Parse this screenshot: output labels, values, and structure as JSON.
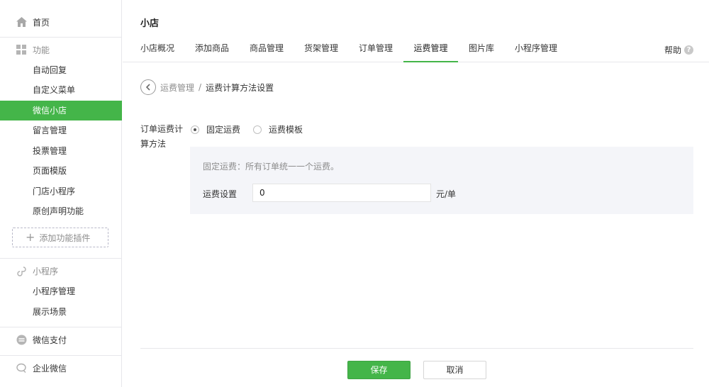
{
  "sidebar": {
    "home": {
      "label": "首页",
      "icon": "home-icon"
    },
    "features": {
      "label": "功能",
      "icon": "grid-icon"
    },
    "feature_items": [
      "自动回复",
      "自定义菜单",
      "微信小店",
      "留言管理",
      "投票管理",
      "页面模版",
      "门店小程序",
      "原创声明功能"
    ],
    "active_item": "微信小店",
    "add_plugin": "添加功能插件",
    "miniprogram": {
      "label": "小程序",
      "icon": "link-icon"
    },
    "miniprogram_items": [
      "小程序管理",
      "展示场景"
    ],
    "wechat_pay": {
      "label": "微信支付",
      "icon": "wallet-icon"
    },
    "work_wechat": {
      "label": "企业微信",
      "icon": "chat-icon"
    }
  },
  "main": {
    "title": "小店",
    "tabs": [
      "小店概况",
      "添加商品",
      "商品管理",
      "货架管理",
      "订单管理",
      "运费管理",
      "图片库",
      "小程序管理"
    ],
    "active_tab": "运费管理",
    "help": "帮助",
    "breadcrumb": {
      "parent": "运费管理",
      "sep": "/",
      "current": "运费计算方法设置"
    },
    "method_label": "订单运费计算方法",
    "options": [
      {
        "label": "固定运费",
        "checked": true
      },
      {
        "label": "运费模板",
        "checked": false
      }
    ],
    "panel": {
      "description": "固定运费：所有订单统一一个运费。",
      "fee_label": "运费设置",
      "fee_value": "0",
      "unit": "元/单"
    },
    "save": "保存",
    "cancel": "取消"
  },
  "colors": {
    "accent": "#44b549"
  }
}
